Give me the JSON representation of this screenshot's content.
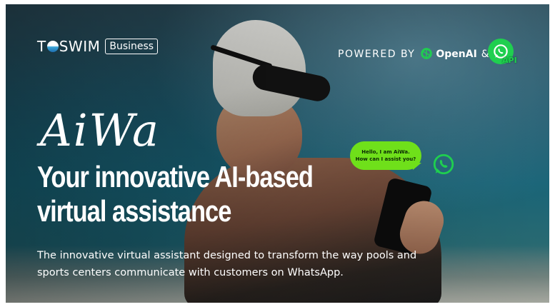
{
  "brand": {
    "logo_text_before": "T",
    "logo_text_after": "SWIM",
    "logo_badge": "Business"
  },
  "powered_by": {
    "label": "POWERED BY",
    "openai_label": "OpenAI",
    "ampersand": "&",
    "whatsapp_api_label": "API"
  },
  "hero": {
    "product_name": "AiWa",
    "headline_line1": "Your innovative AI-based",
    "headline_line2": "virtual assistance",
    "subtitle_line1": "The innovative virtual assistant designed to transform the way pools and",
    "subtitle_line2": "sports centers communicate with customers on WhatsApp."
  },
  "chat_bubble": {
    "line1": "Hello, I am AiWa.",
    "line2": "How can I assist you?"
  },
  "colors": {
    "whatsapp_green": "#1fcf4f",
    "bubble_green": "#6fe01a",
    "text": "#ffffff"
  },
  "icons": {
    "openai": "openai-logo-icon",
    "whatsapp": "whatsapp-icon"
  }
}
